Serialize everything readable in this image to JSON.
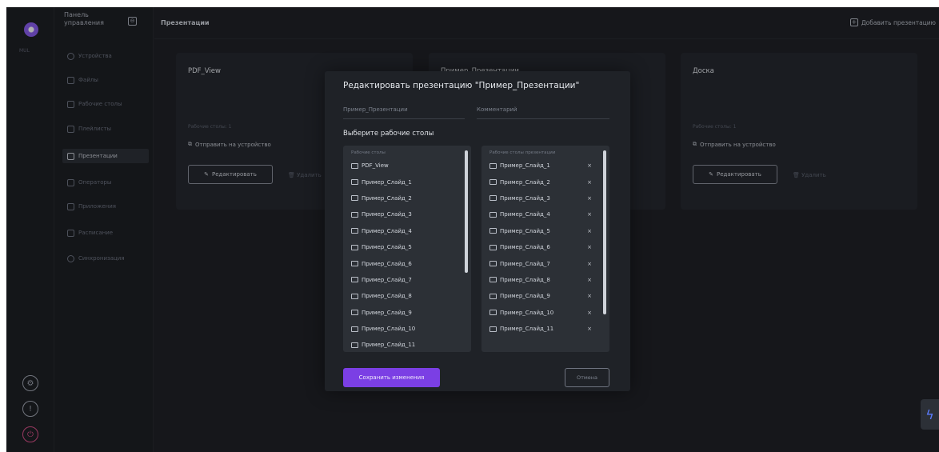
{
  "rail": {
    "label": "MUL"
  },
  "nav": {
    "title": "Панель управления",
    "items": [
      {
        "label": "Устройства",
        "icon": "settings-icon"
      },
      {
        "label": "Файлы",
        "icon": "grid-icon"
      },
      {
        "label": "Рабочие столы",
        "icon": "monitor-icon"
      },
      {
        "label": "Плейлисты",
        "icon": "list-icon"
      },
      {
        "label": "Презентации",
        "icon": "presentation-icon"
      },
      {
        "label": "Операторы",
        "icon": "user-icon"
      },
      {
        "label": "Приложения",
        "icon": "apps-icon"
      },
      {
        "label": "Расписание",
        "icon": "calendar-icon"
      },
      {
        "label": "Синхронизация",
        "icon": "sync-icon"
      }
    ]
  },
  "topbar": {
    "title": "Презентации",
    "add_label": "Добавить презентацию"
  },
  "cards": [
    {
      "title": "PDF_View",
      "sub": "Рабочие столы: 1",
      "send": "Отправить на устройство",
      "edit": "Редактировать",
      "del": "Удалить"
    },
    {
      "title": "Пример_Презентации"
    },
    {
      "title": "Доска",
      "sub": "Рабочие столы: 1",
      "send": "Отправить на устройство",
      "edit": "Редактировать",
      "del": "Удалить"
    }
  ],
  "modal": {
    "title": "Редактировать презентацию \"Пример_Презентации\"",
    "name_value": "Пример_Презентации",
    "comment_placeholder": "Комментарий",
    "section_title": "Выберите рабочие столы",
    "available": {
      "header": "Рабочие столы",
      "items": [
        "PDF_View",
        "Пример_Слайд_1",
        "Пример_Слайд_2",
        "Пример_Слайд_3",
        "Пример_Слайд_4",
        "Пример_Слайд_5",
        "Пример_Слайд_6",
        "Пример_Слайд_7",
        "Пример_Слайд_8",
        "Пример_Слайд_9",
        "Пример_Слайд_10",
        "Пример_Слайд_11"
      ]
    },
    "selected": {
      "header": "Рабочие столы презентации",
      "items": [
        "Пример_Слайд_1",
        "Пример_Слайд_2",
        "Пример_Слайд_3",
        "Пример_Слайд_4",
        "Пример_Слайд_5",
        "Пример_Слайд_6",
        "Пример_Слайд_7",
        "Пример_Слайд_8",
        "Пример_Слайд_9",
        "Пример_Слайд_10",
        "Пример_Слайд_11"
      ],
      "remove_glyph": "×"
    },
    "save_label": "Сохранить изменения",
    "cancel_label": "Отмена"
  },
  "colors": {
    "accent": "#7b3fe4",
    "background": "#1c1e22",
    "panel": "#23262b"
  }
}
